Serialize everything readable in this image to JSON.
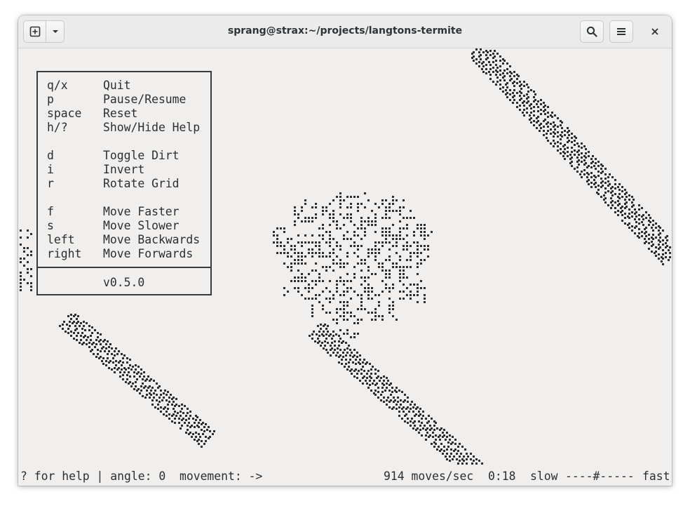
{
  "window": {
    "title": "sprang@strax:~/projects/langtons-termite"
  },
  "icons": {
    "new_tab": "new-tab-icon",
    "dropdown": "chevron-down-icon",
    "search": "search-icon",
    "menu": "hamburger-menu-icon",
    "close": "close-icon"
  },
  "help": {
    "groups": [
      [
        {
          "key": "q/x",
          "action": "Quit"
        },
        {
          "key": "p",
          "action": "Pause/Resume"
        },
        {
          "key": "space",
          "action": "Reset"
        },
        {
          "key": "h/?",
          "action": "Show/Hide Help"
        }
      ],
      [
        {
          "key": "d",
          "action": "Toggle Dirt"
        },
        {
          "key": "i",
          "action": "Invert"
        },
        {
          "key": "r",
          "action": "Rotate Grid"
        }
      ],
      [
        {
          "key": "f",
          "action": "Move Faster"
        },
        {
          "key": "s",
          "action": "Move Slower"
        },
        {
          "key": "left",
          "action": "Move Backwards"
        },
        {
          "key": "right",
          "action": "Move Forwards"
        }
      ]
    ],
    "version": "v0.5.0"
  },
  "status": {
    "help_hint": "? for help | angle: 0  movement: ->",
    "rate": "914 moves/sec",
    "time": "0:18",
    "speed_slow": "slow",
    "speed_bar": "----#-----",
    "speed_fast": "fast"
  },
  "colors": {
    "terminal_bg": "#f0efee",
    "foreground": "#2e2e2e",
    "headerbar": "#ebebeb"
  }
}
